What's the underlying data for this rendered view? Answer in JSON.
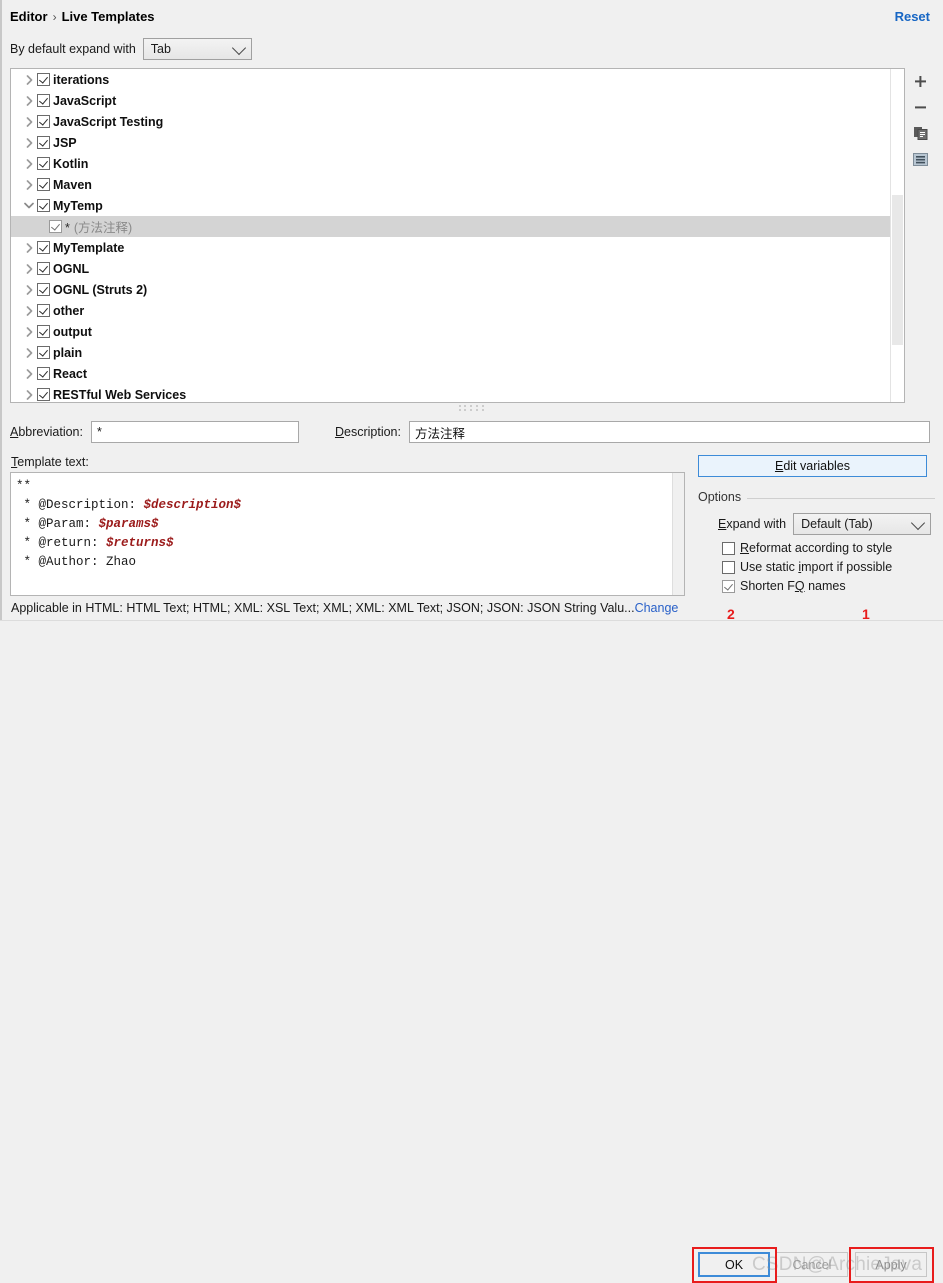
{
  "header": {
    "breadcrumb_root": "Editor",
    "breadcrumb_separator": "›",
    "breadcrumb_current": "Live Templates",
    "reset_label": "Reset",
    "accent_color": "#1766c4"
  },
  "expand_with": {
    "label": "By default expand with",
    "value": "Tab"
  },
  "tree": {
    "rows": [
      {
        "label": "iterations",
        "indent": "group",
        "expanded": false,
        "checked": true
      },
      {
        "label": "JavaScript",
        "indent": "group",
        "expanded": false,
        "checked": true
      },
      {
        "label": "JavaScript Testing",
        "indent": "group",
        "expanded": false,
        "checked": true
      },
      {
        "label": "JSP",
        "indent": "group",
        "expanded": false,
        "checked": true
      },
      {
        "label": "Kotlin",
        "indent": "group",
        "expanded": false,
        "checked": true
      },
      {
        "label": "Maven",
        "indent": "group",
        "expanded": false,
        "checked": true
      },
      {
        "label": "MyTemp",
        "indent": "group",
        "expanded": true,
        "checked": true
      },
      {
        "label": "*",
        "description": "(方法注释)",
        "indent": "child",
        "selected": true,
        "checked": true
      },
      {
        "label": "MyTemplate",
        "indent": "group",
        "expanded": false,
        "checked": true
      },
      {
        "label": "OGNL",
        "indent": "group",
        "expanded": false,
        "checked": true
      },
      {
        "label": "OGNL (Struts 2)",
        "indent": "group",
        "expanded": false,
        "checked": true
      },
      {
        "label": "other",
        "indent": "group",
        "expanded": false,
        "checked": true
      },
      {
        "label": "output",
        "indent": "group",
        "expanded": false,
        "checked": true
      },
      {
        "label": "plain",
        "indent": "group",
        "expanded": false,
        "checked": true
      },
      {
        "label": "React",
        "indent": "group",
        "expanded": false,
        "checked": true
      },
      {
        "label": "RESTful Web Services",
        "indent": "group",
        "expanded": false,
        "checked": true
      }
    ]
  },
  "side_toolbar": {
    "add": "plus-icon",
    "remove": "minus-icon",
    "duplicate": "copy-icon",
    "group": "list-icon"
  },
  "form": {
    "abbreviation_label": "Abbreviation:",
    "abbreviation_value": "*",
    "description_label": "Description:",
    "description_value": "方法注释"
  },
  "template_text": {
    "label": "Template text:",
    "lines": [
      {
        "prefix": "**",
        "var": "",
        "suffix": ""
      },
      {
        "prefix": " * @Description: ",
        "var": "$description$",
        "suffix": ""
      },
      {
        "prefix": " * @Param: ",
        "var": "$params$",
        "suffix": ""
      },
      {
        "prefix": " * @return: ",
        "var": "$returns$",
        "suffix": ""
      },
      {
        "prefix": " * @Author: Zhao",
        "var": "",
        "suffix": ""
      }
    ],
    "variable_color": "#9b1b1b"
  },
  "edit_variables": {
    "label_before": "E",
    "label_accel": "",
    "label": "Edit variables"
  },
  "options": {
    "title": "Options",
    "expand_with_label": "Expand with",
    "expand_with_value": "Default (Tab)",
    "checkboxes": [
      {
        "label": "Reformat according to style",
        "checked": false
      },
      {
        "label": "Use static import if possible",
        "checked": false
      },
      {
        "label": "Shorten FQ names",
        "checked": true
      }
    ]
  },
  "applicable": {
    "text": "Applicable in HTML: HTML Text; HTML; XML: XSL Text; XML; XML: XML Text; JSON; JSON: JSON String Valu...",
    "change_link": "Change"
  },
  "buttons": {
    "ok": "OK",
    "cancel": "Cancel",
    "apply": "Apply"
  },
  "annotations": {
    "number_apply": "1",
    "number_ok": "2",
    "color": "#e81c1c"
  },
  "watermark": {
    "text": "CSDN@ArchieJava"
  }
}
